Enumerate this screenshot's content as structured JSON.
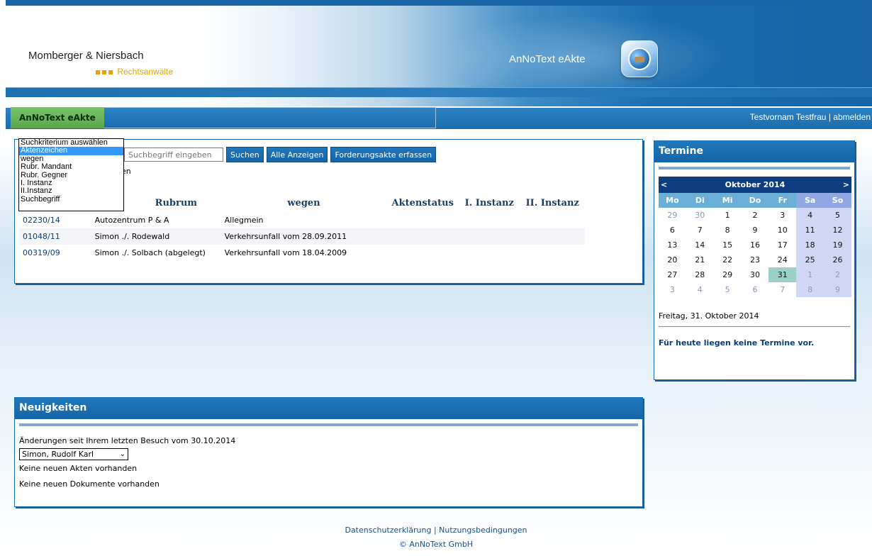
{
  "header": {
    "firm_name": "Momberger & Niersbach",
    "firm_sub": "Rechtsanwälte",
    "app_title": "AnNoText eAkte",
    "logo_icon": "globe-briefcase-icon"
  },
  "nav": {
    "active_tab": "AnNoText eAkte",
    "user_name": "Testvornam Testfrau",
    "separator": "|",
    "logout": "abmelden"
  },
  "search": {
    "dropdown_options": [
      "Suchkriterium auswählen",
      "Aktenzeichen",
      "wegen",
      "Rubr. Mandant",
      "Rubr. Gegner",
      "I. Instanz",
      "II.Instanz",
      "Suchbegriff"
    ],
    "dropdown_selected": "Aktenzeichen",
    "input_placeholder": "Suchbegriff eingeben",
    "btn_search": "Suchen",
    "btn_show_all": "Alle Anzeigen",
    "btn_create": "Forderungsakte erfassen",
    "hint_partial": "en"
  },
  "table": {
    "headers": [
      "Rubrum",
      "wegen",
      "Aktenstatus",
      "I. Instanz",
      "II. Instanz"
    ],
    "rows": [
      {
        "az": "02230/14",
        "rubrum": "Autozentrum P & A",
        "wegen": "Allegmein"
      },
      {
        "az": "01048/11",
        "rubrum": "Simon ./. Rodewald",
        "wegen": "Verkehrsunfall vom 28.09.2011"
      },
      {
        "az": "00319/09",
        "rubrum": "Simon ./. Solbach (abgelegt)",
        "wegen": "Verkehrsunfall vom 18.04.2009"
      }
    ]
  },
  "termine": {
    "title": "Termine",
    "prev": "<",
    "next": ">",
    "month": "Oktober 2014",
    "day_names": [
      "Mo",
      "Di",
      "Mi",
      "Do",
      "Fr",
      "Sa",
      "So"
    ],
    "weeks": [
      [
        "29",
        "30",
        "1",
        "2",
        "3",
        "4",
        "5"
      ],
      [
        "6",
        "7",
        "8",
        "9",
        "10",
        "11",
        "12"
      ],
      [
        "13",
        "14",
        "15",
        "16",
        "17",
        "18",
        "19"
      ],
      [
        "20",
        "21",
        "22",
        "23",
        "24",
        "25",
        "26"
      ],
      [
        "27",
        "28",
        "29",
        "30",
        "31",
        "1",
        "2"
      ],
      [
        "3",
        "4",
        "5",
        "6",
        "7",
        "8",
        "9"
      ]
    ],
    "selected_date": "Freitag, 31. Oktober 2014",
    "no_events": "Für heute liegen keine Termine vor."
  },
  "news": {
    "title": "Neuigkeiten",
    "changes_since": "Änderungen seit Ihrem letzten Besuch vom 30.10.2014",
    "client_select": "Simon, Rudolf Karl",
    "no_new_files": "Keine neuen Akten vorhanden",
    "no_new_docs": "Keine neuen Dokumente vorhanden"
  },
  "footer": {
    "privacy": "Datenschutzerklärung",
    "sep": "|",
    "terms": "Nutzungsbedingungen",
    "copyright": "© AnNoText GmbH"
  }
}
